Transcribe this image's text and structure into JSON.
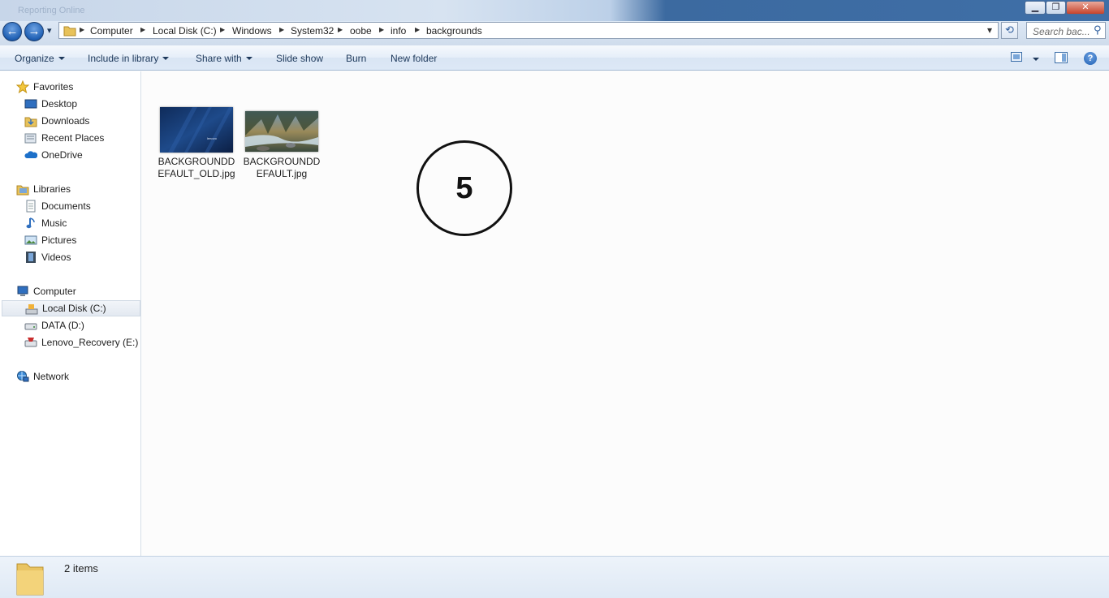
{
  "window": {
    "title_faded": "Reporting Online",
    "controls": {
      "minimize": "▁",
      "maximize": "❐",
      "close": "✕"
    }
  },
  "navigation": {
    "back_icon": "back-arrow-icon",
    "forward_icon": "forward-arrow-icon",
    "back_glyph": "←",
    "forward_glyph": "→",
    "recent_glyph": "▾"
  },
  "address": {
    "crumbs": [
      "Computer",
      "Local Disk (C:)",
      "Windows",
      "System32",
      "oobe",
      "info",
      "backgrounds"
    ],
    "separator": "▶",
    "dropdown_glyph": "▾",
    "refresh_glyph": "⟲"
  },
  "search": {
    "placeholder": "Search bac...",
    "icon": "magnifier-icon",
    "glyph": "⚲"
  },
  "toolbar": {
    "organize": "Organize",
    "include_in_library": "Include in library",
    "share_with": "Share with",
    "slide_show": "Slide show",
    "burn": "Burn",
    "new_folder": "New folder",
    "help_glyph": "?"
  },
  "nav_pane": {
    "favorites": {
      "label": "Favorites",
      "items": [
        "Desktop",
        "Downloads",
        "Recent Places",
        "OneDrive"
      ]
    },
    "libraries": {
      "label": "Libraries",
      "items": [
        "Documents",
        "Music",
        "Pictures",
        "Videos"
      ]
    },
    "computer": {
      "label": "Computer",
      "items": [
        "Local Disk (C:)",
        "DATA (D:)",
        "Lenovo_Recovery (E:)"
      ]
    },
    "network": {
      "label": "Network"
    }
  },
  "files": [
    {
      "name": "BACKGROUNDDEFAULT_OLD.jpg",
      "thumb_text": "lenovo"
    },
    {
      "name": "BACKGROUNDDEFAULT.jpg"
    }
  ],
  "marker": {
    "number": "5"
  },
  "status": {
    "item_count": "2 items"
  },
  "colors": {
    "accent": "#1e5fb3",
    "toolbar_text": "#1e395b",
    "selection": "#e3e9f1"
  }
}
